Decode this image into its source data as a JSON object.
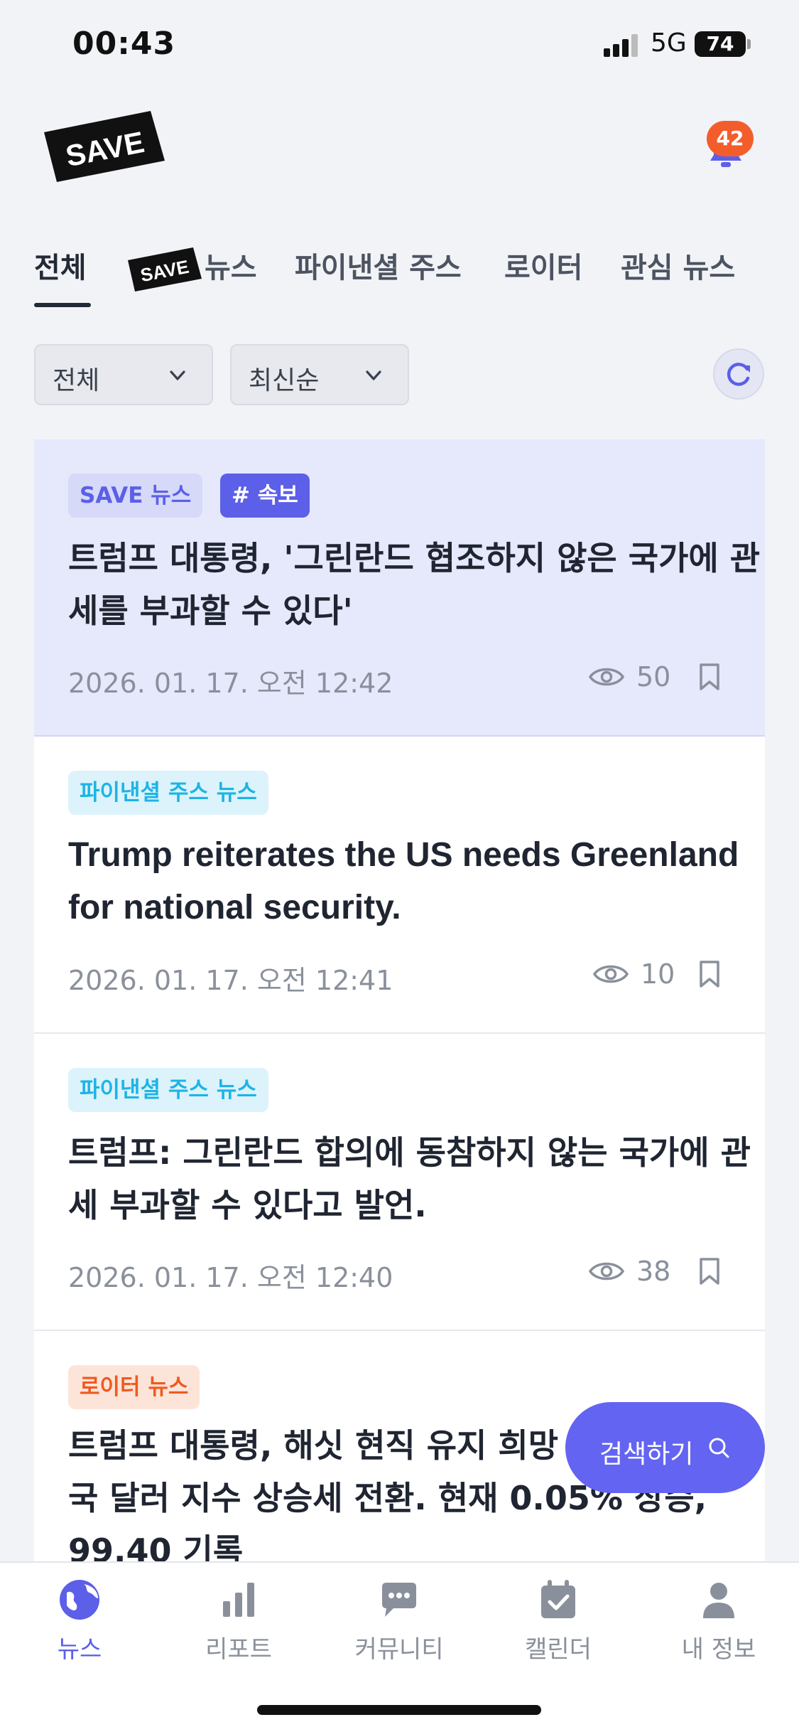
{
  "status_bar": {
    "time": "00:43",
    "network": "5G",
    "battery": "74"
  },
  "header": {
    "logo_text": "SAVE",
    "notification_count": "42"
  },
  "tabs": [
    {
      "label": "전체",
      "active": true
    },
    {
      "label": "뉴스",
      "logo_text": "SAVE"
    },
    {
      "label": "파이낸셜 주스"
    },
    {
      "label": "로이터"
    },
    {
      "label": "관심 뉴스"
    }
  ],
  "filters": {
    "category": "전체",
    "sort": "최신순"
  },
  "feed": [
    {
      "tags": [
        "SAVE 뉴스",
        "# 속보"
      ],
      "title": "트럼프 대통령, '그린란드 협조하지 않은 국가에 관세를 부과할 수 있다'",
      "date": "2026. 01. 17. 오전 12:42",
      "views": "50"
    },
    {
      "tags": [
        "파이낸셜 주스 뉴스"
      ],
      "title": "Trump reiterates the US needs Greenland for national security.",
      "date": "2026. 01. 17. 오전 12:41",
      "views": "10"
    },
    {
      "tags": [
        "파이낸셜 주스 뉴스"
      ],
      "title": "트럼프: 그린란드 합의에 동참하지 않는 국가에 관세 부과할 수 있다고 발언.",
      "date": "2026. 01. 17. 오전 12:40",
      "views": "38"
    },
    {
      "tags": [
        "로이터 뉴스"
      ],
      "title": "트럼프 대통령, 해싯 현직 유지 희망",
      "title_line2": "국 달러 지수 상승세 전환. 현재 0.05% 상승,",
      "title_line3": "99.40 기록"
    }
  ],
  "search_fab": {
    "label": "검색하기"
  },
  "bottom_nav": [
    {
      "label": "뉴스",
      "icon": "globe-icon",
      "active": true
    },
    {
      "label": "리포트",
      "icon": "bar-chart-icon"
    },
    {
      "label": "커뮤니티",
      "icon": "chat-bubble-icon"
    },
    {
      "label": "캘린더",
      "icon": "calendar-check-icon"
    },
    {
      "label": "내 정보",
      "icon": "person-icon"
    }
  ],
  "colors": {
    "accent": "#5c5fe8",
    "highlight_bg": "#e6e8fc",
    "badge": "#f35d2c",
    "fin_tag": "#1db4e6",
    "reuters_tag": "#f05a1f"
  }
}
